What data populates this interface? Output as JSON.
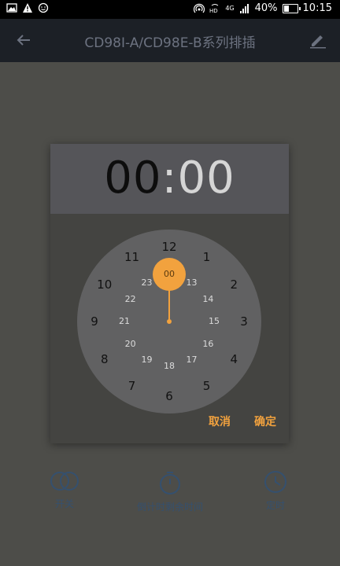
{
  "status_bar": {
    "network": "4G",
    "battery": "40%",
    "battery_level": 0.4,
    "time": "10:15"
  },
  "app_bar": {
    "title": "CD98I-A/CD98E-B系列排插",
    "back_icon": "arrow-left-icon",
    "edit_icon": "pencil-icon"
  },
  "dialog": {
    "hours": "00",
    "separator": ":",
    "minutes": "00",
    "selected_value": "00",
    "outer_numbers": [
      "12",
      "1",
      "2",
      "3",
      "4",
      "5",
      "6",
      "7",
      "8",
      "9",
      "10",
      "11"
    ],
    "inner_numbers": [
      "13",
      "14",
      "15",
      "16",
      "17",
      "18",
      "19",
      "20",
      "21",
      "22",
      "23"
    ],
    "cancel_label": "取消",
    "confirm_label": "确定",
    "accent_color": "#f2a23e"
  },
  "bottom_bar": {
    "items": [
      {
        "label": "开关",
        "icon": "toggle-icon"
      },
      {
        "label": "倒计时剩余时间",
        "icon": "stopwatch-icon"
      },
      {
        "label": "定时",
        "icon": "clock-icon"
      }
    ]
  }
}
